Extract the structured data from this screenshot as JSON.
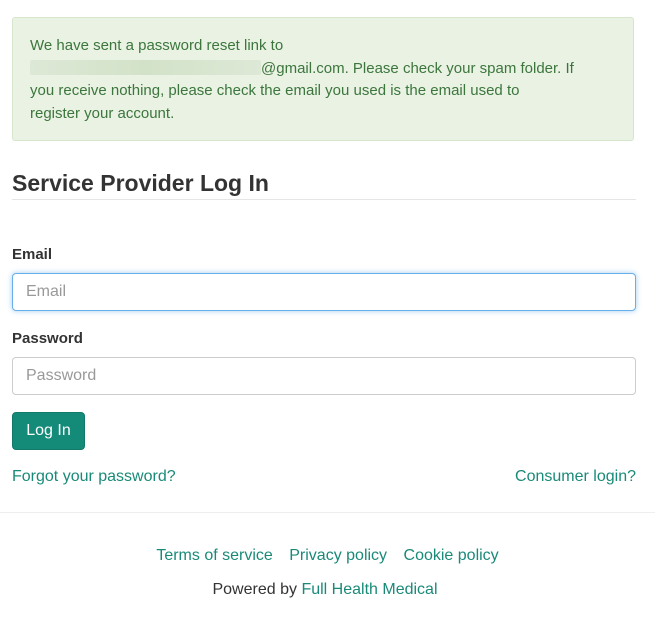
{
  "alert": {
    "line1": "We have sent a password reset link to",
    "email_suffix": "@gmail.com. Please check your spam folder. If",
    "line3": "you receive nothing, please check the email you used is the email used to",
    "line4": "register your account."
  },
  "page_title": "Service Provider Log In",
  "form": {
    "email_label": "Email",
    "email_placeholder": "Email",
    "password_label": "Password",
    "password_placeholder": "Password",
    "login_button": "Log In"
  },
  "links": {
    "forgot_password": "Forgot your password?",
    "consumer_login": "Consumer login?"
  },
  "footer": {
    "terms": "Terms of service",
    "privacy": "Privacy policy",
    "cookie": "Cookie policy",
    "powered_by": "Powered by",
    "company": "Full Health Medical"
  }
}
